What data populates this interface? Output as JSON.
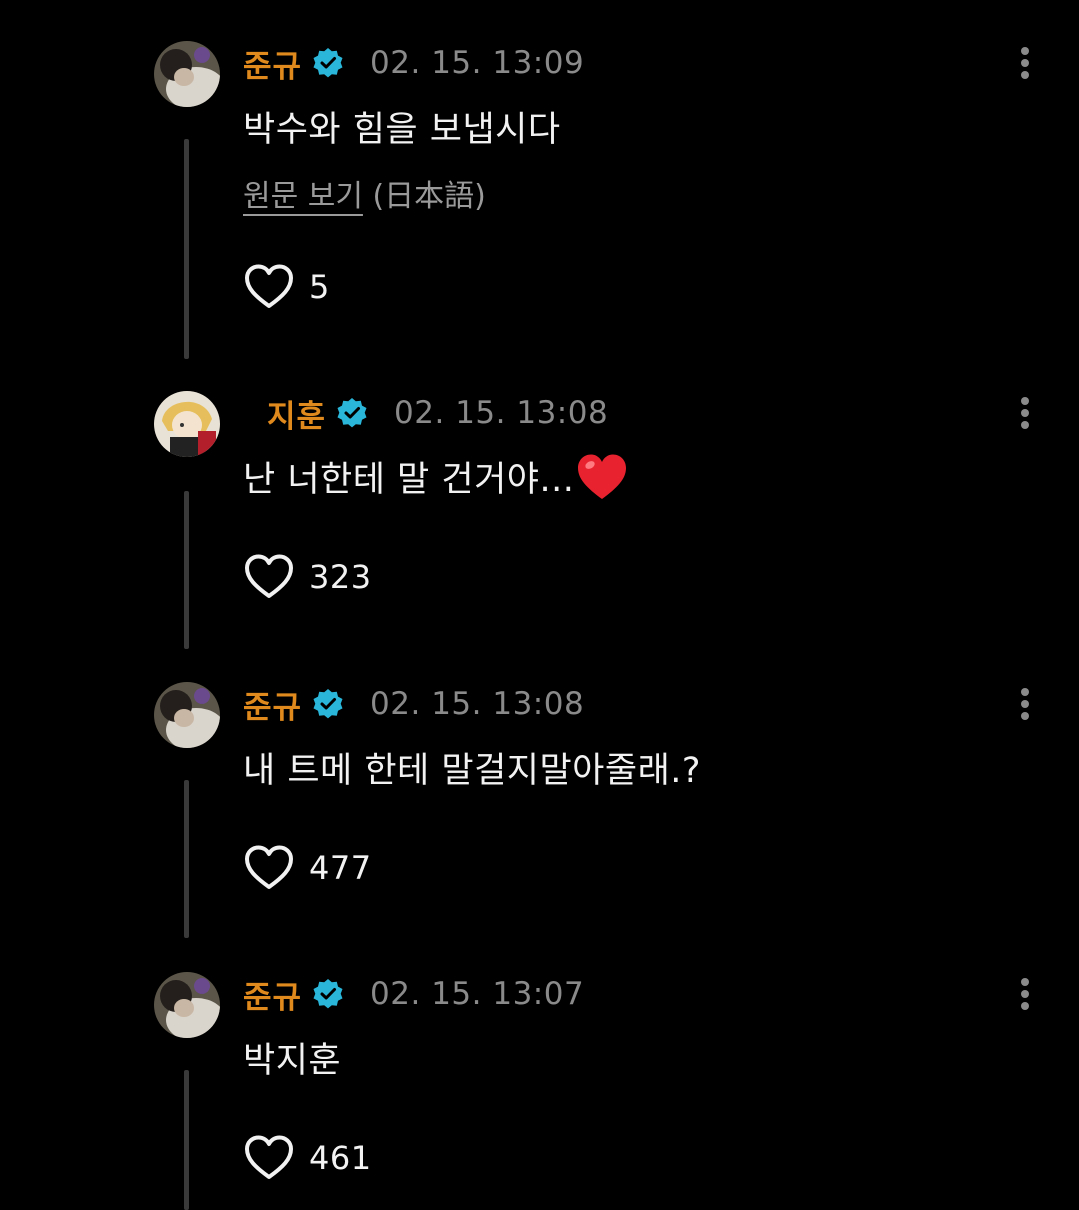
{
  "comments": [
    {
      "username": "준규",
      "timestamp": "02. 15. 13:09",
      "text": "박수와 힘을 보냅시다",
      "translate_link": "원문 보기",
      "translate_lang": " (日本語)",
      "likes": "5",
      "avatar": "junkyu-avatar"
    },
    {
      "username": "지훈",
      "timestamp": "02. 15. 13:08",
      "text": "난 너한테 말 건거야...",
      "likes": "323",
      "avatar": "jihoon-avatar"
    },
    {
      "username": "준규",
      "timestamp": "02. 15. 13:08",
      "text": "내 트메 한테 말걸지말아줄래.?",
      "likes": "477",
      "avatar": "junkyu-avatar"
    },
    {
      "username": "준규",
      "timestamp": "02. 15. 13:07",
      "text": "박지훈",
      "likes": "461",
      "avatar": "junkyu-avatar"
    }
  ],
  "colors": {
    "background": "#000000",
    "username": "#e0891c",
    "verified": "#29b6d9",
    "timestamp": "#8a8a8a",
    "thread_line": "#3a3a3a"
  },
  "icons": {
    "verified": "verified-badge-icon",
    "more": "more-vertical-icon",
    "like": "heart-outline-icon",
    "emoji": "red-heart-emoji"
  }
}
